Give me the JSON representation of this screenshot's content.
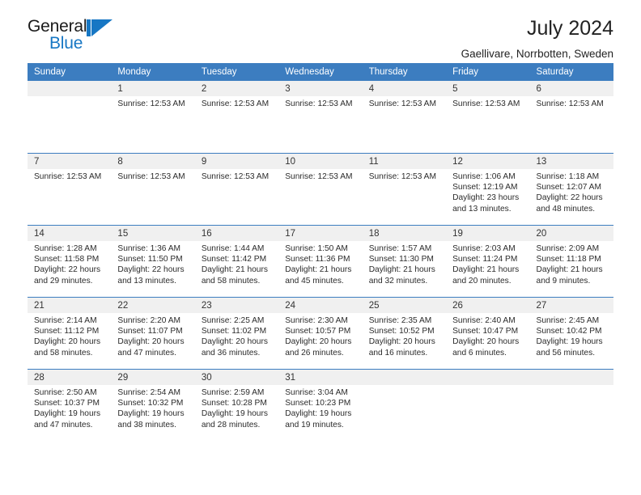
{
  "brand": {
    "name_part1": "General",
    "name_part2": "Blue",
    "mark": "triangle-logo",
    "accent_color": "#1777c4"
  },
  "header": {
    "title": "July 2024",
    "subtitle": "Gaellivare, Norrbotten, Sweden"
  },
  "theme": {
    "header_row_bg": "#3c7dc0",
    "daynum_bg": "#f0f0f0",
    "row_divider": "#3c7dc0",
    "text": "#2b2b2b"
  },
  "calendar": {
    "weekday_headers": [
      "Sunday",
      "Monday",
      "Tuesday",
      "Wednesday",
      "Thursday",
      "Friday",
      "Saturday"
    ],
    "weeks": [
      [
        {
          "day": "",
          "lines": []
        },
        {
          "day": "1",
          "lines": [
            "Sunrise: 12:53 AM"
          ]
        },
        {
          "day": "2",
          "lines": [
            "Sunrise: 12:53 AM"
          ]
        },
        {
          "day": "3",
          "lines": [
            "Sunrise: 12:53 AM"
          ]
        },
        {
          "day": "4",
          "lines": [
            "Sunrise: 12:53 AM"
          ]
        },
        {
          "day": "5",
          "lines": [
            "Sunrise: 12:53 AM"
          ]
        },
        {
          "day": "6",
          "lines": [
            "Sunrise: 12:53 AM"
          ]
        }
      ],
      [
        {
          "day": "7",
          "lines": [
            "Sunrise: 12:53 AM"
          ]
        },
        {
          "day": "8",
          "lines": [
            "Sunrise: 12:53 AM"
          ]
        },
        {
          "day": "9",
          "lines": [
            "Sunrise: 12:53 AM"
          ]
        },
        {
          "day": "10",
          "lines": [
            "Sunrise: 12:53 AM"
          ]
        },
        {
          "day": "11",
          "lines": [
            "Sunrise: 12:53 AM"
          ]
        },
        {
          "day": "12",
          "lines": [
            "Sunrise: 1:06 AM",
            "Sunset: 12:19 AM",
            "Daylight: 23 hours and 13 minutes."
          ]
        },
        {
          "day": "13",
          "lines": [
            "Sunrise: 1:18 AM",
            "Sunset: 12:07 AM",
            "Daylight: 22 hours and 48 minutes."
          ]
        }
      ],
      [
        {
          "day": "14",
          "lines": [
            "Sunrise: 1:28 AM",
            "Sunset: 11:58 PM",
            "Daylight: 22 hours and 29 minutes."
          ]
        },
        {
          "day": "15",
          "lines": [
            "Sunrise: 1:36 AM",
            "Sunset: 11:50 PM",
            "Daylight: 22 hours and 13 minutes."
          ]
        },
        {
          "day": "16",
          "lines": [
            "Sunrise: 1:44 AM",
            "Sunset: 11:42 PM",
            "Daylight: 21 hours and 58 minutes."
          ]
        },
        {
          "day": "17",
          "lines": [
            "Sunrise: 1:50 AM",
            "Sunset: 11:36 PM",
            "Daylight: 21 hours and 45 minutes."
          ]
        },
        {
          "day": "18",
          "lines": [
            "Sunrise: 1:57 AM",
            "Sunset: 11:30 PM",
            "Daylight: 21 hours and 32 minutes."
          ]
        },
        {
          "day": "19",
          "lines": [
            "Sunrise: 2:03 AM",
            "Sunset: 11:24 PM",
            "Daylight: 21 hours and 20 minutes."
          ]
        },
        {
          "day": "20",
          "lines": [
            "Sunrise: 2:09 AM",
            "Sunset: 11:18 PM",
            "Daylight: 21 hours and 9 minutes."
          ]
        }
      ],
      [
        {
          "day": "21",
          "lines": [
            "Sunrise: 2:14 AM",
            "Sunset: 11:12 PM",
            "Daylight: 20 hours and 58 minutes."
          ]
        },
        {
          "day": "22",
          "lines": [
            "Sunrise: 2:20 AM",
            "Sunset: 11:07 PM",
            "Daylight: 20 hours and 47 minutes."
          ]
        },
        {
          "day": "23",
          "lines": [
            "Sunrise: 2:25 AM",
            "Sunset: 11:02 PM",
            "Daylight: 20 hours and 36 minutes."
          ]
        },
        {
          "day": "24",
          "lines": [
            "Sunrise: 2:30 AM",
            "Sunset: 10:57 PM",
            "Daylight: 20 hours and 26 minutes."
          ]
        },
        {
          "day": "25",
          "lines": [
            "Sunrise: 2:35 AM",
            "Sunset: 10:52 PM",
            "Daylight: 20 hours and 16 minutes."
          ]
        },
        {
          "day": "26",
          "lines": [
            "Sunrise: 2:40 AM",
            "Sunset: 10:47 PM",
            "Daylight: 20 hours and 6 minutes."
          ]
        },
        {
          "day": "27",
          "lines": [
            "Sunrise: 2:45 AM",
            "Sunset: 10:42 PM",
            "Daylight: 19 hours and 56 minutes."
          ]
        }
      ],
      [
        {
          "day": "28",
          "lines": [
            "Sunrise: 2:50 AM",
            "Sunset: 10:37 PM",
            "Daylight: 19 hours and 47 minutes."
          ]
        },
        {
          "day": "29",
          "lines": [
            "Sunrise: 2:54 AM",
            "Sunset: 10:32 PM",
            "Daylight: 19 hours and 38 minutes."
          ]
        },
        {
          "day": "30",
          "lines": [
            "Sunrise: 2:59 AM",
            "Sunset: 10:28 PM",
            "Daylight: 19 hours and 28 minutes."
          ]
        },
        {
          "day": "31",
          "lines": [
            "Sunrise: 3:04 AM",
            "Sunset: 10:23 PM",
            "Daylight: 19 hours and 19 minutes."
          ]
        },
        {
          "day": "",
          "lines": []
        },
        {
          "day": "",
          "lines": []
        },
        {
          "day": "",
          "lines": []
        }
      ]
    ]
  }
}
